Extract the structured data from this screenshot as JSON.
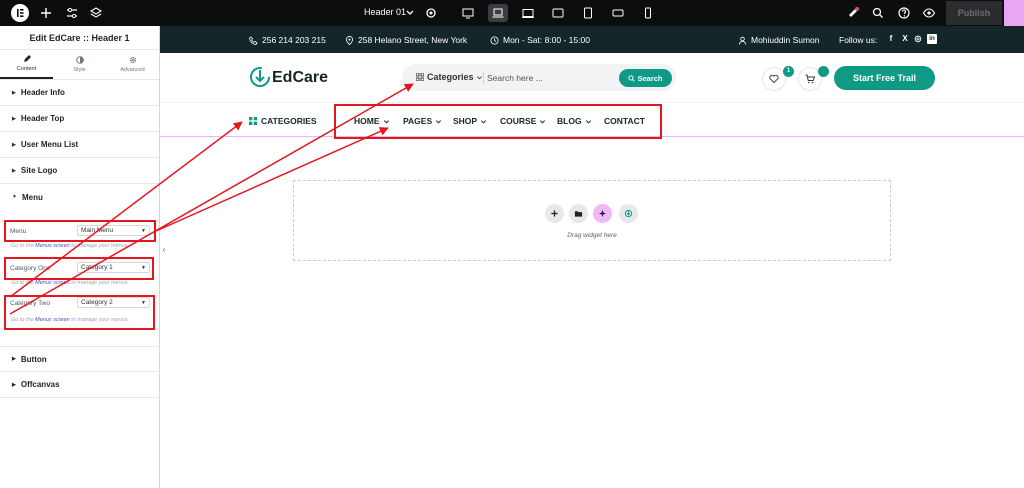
{
  "toolbar": {
    "document_name": "Header 01",
    "publish_label": "Publish"
  },
  "panel": {
    "title": "Edit EdCare :: Header 1",
    "tabs": [
      "Content",
      "Style",
      "Advanced"
    ],
    "sections_top": [
      "Header Info",
      "Header Top",
      "User Menu List",
      "Site Logo",
      "Menu"
    ],
    "controls": [
      {
        "label": "Menu",
        "value": "Main Menu"
      },
      {
        "label": "Category One",
        "value": "Category 1"
      },
      {
        "label": "Category Two",
        "value": "Category 2"
      }
    ],
    "help_prefix": "Go to the ",
    "help_link": "Menus screen",
    "help_suffix": " to manage your menus.",
    "sections_bottom": [
      "Button",
      "Offcanvas"
    ]
  },
  "infobar": {
    "phone": "256 214 203 215",
    "address": "258 Helano Street, New York",
    "hours": "Mon - Sat: 8:00 - 15:00",
    "user": "Mohiuddin Sumon",
    "follow_label": "Follow us:",
    "social": [
      "f",
      "X",
      "◎",
      "in"
    ]
  },
  "header": {
    "logo_text": "EdCare",
    "category_dropdown": "Categories",
    "search_placeholder": "Search here ...",
    "search_button": "Search",
    "wishlist_count": "1",
    "cta_label": "Start Free Trail"
  },
  "nav": {
    "categories_label": "CATEGORIES",
    "items": [
      "HOME",
      "PAGES",
      "SHOP",
      "COURSE",
      "BLOG",
      "CONTACT"
    ]
  },
  "canvas": {
    "drag_text": "Drag widget here"
  },
  "colors": {
    "brand": "#0f9a85",
    "dark": "#14262a",
    "annotation": "#e4171f"
  }
}
